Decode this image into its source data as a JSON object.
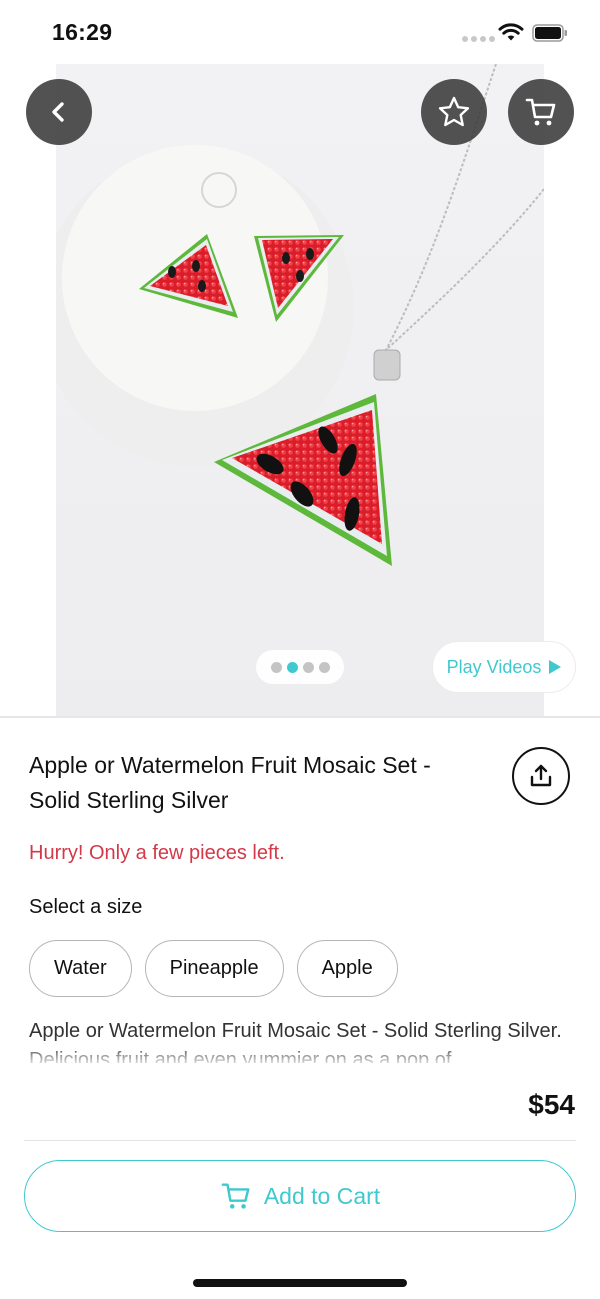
{
  "status_bar": {
    "time": "16:29",
    "icons": [
      "signal-icon",
      "wifi-icon",
      "battery-icon"
    ]
  },
  "header": {
    "back_icon": "chevron-left-icon",
    "favorite_icon": "star-icon",
    "cart_icon": "cart-icon"
  },
  "gallery": {
    "image_count": 4,
    "active_index": 1,
    "play_videos_label": "Play Videos"
  },
  "product": {
    "title_line1": "Apple or Watermelon Fruit Mosaic Set -",
    "title_line2": "Solid Sterling Silver",
    "stock_message": "Hurry! Only a few pieces left.",
    "size_label": "Select a size",
    "sizes": [
      {
        "label": "Water"
      },
      {
        "label": "Pineapple"
      },
      {
        "label": "Apple"
      }
    ],
    "description": "Apple or Watermelon Fruit Mosaic Set - Solid Sterling Silver. Delicious fruit and even yummier on as a pop of"
  },
  "purchase": {
    "price": "$54",
    "add_to_cart_label": "Add to Cart"
  },
  "colors": {
    "accent": "#3fc9cf",
    "warning": "#d23a4a",
    "button_overlay": "#3a3a3a"
  }
}
